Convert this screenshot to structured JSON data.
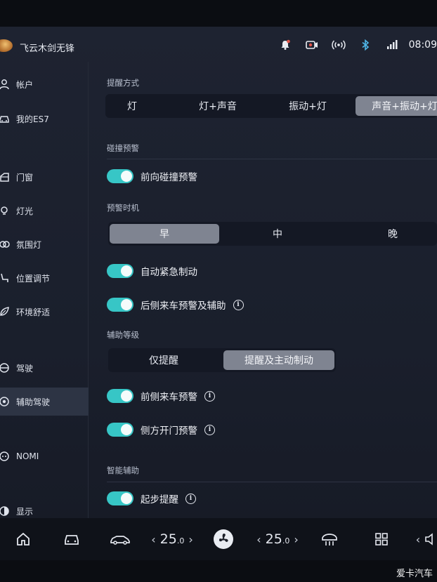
{
  "status_bar": {
    "username": "飞云木剑无锋",
    "time": "08:09",
    "icons": [
      "bell-icon",
      "camera-record-icon",
      "wireless-signal-icon",
      "bluetooth-icon",
      "cellular-signal-icon"
    ]
  },
  "sidebar": {
    "items": [
      {
        "label": "帐户",
        "icon": "user-icon"
      },
      {
        "label": "我的ES7",
        "icon": "car-icon"
      },
      {
        "label": "门窗",
        "icon": "door-icon"
      },
      {
        "label": "灯光",
        "icon": "light-icon"
      },
      {
        "label": "氛围灯",
        "icon": "ambient-light-icon"
      },
      {
        "label": "位置调节",
        "icon": "seat-icon"
      },
      {
        "label": "环境舒适",
        "icon": "leaf-icon"
      },
      {
        "label": "驾驶",
        "icon": "steering-wheel-icon"
      },
      {
        "label": "辅助驾驶",
        "icon": "assist-driving-icon",
        "active": true
      },
      {
        "label": "NOMI",
        "icon": "nomi-icon"
      },
      {
        "label": "显示",
        "icon": "display-icon"
      }
    ]
  },
  "main": {
    "alert_mode": {
      "title": "提醒方式",
      "options": [
        "灯",
        "灯+声音",
        "振动+灯",
        "声音+振动+灯"
      ],
      "selected": "声音+振动+灯"
    },
    "collision": {
      "title": "碰撞预警",
      "forward_collision": {
        "label": "前向碰撞预警",
        "on": true
      }
    },
    "timing": {
      "title": "预警时机",
      "options": [
        "早",
        "中",
        "晚"
      ],
      "selected": "早"
    },
    "aeb": {
      "label": "自动紧急制动",
      "on": true
    },
    "rear_cross": {
      "label": "后侧来车预警及辅助",
      "on": true,
      "info": "i"
    },
    "assist_level": {
      "title": "辅助等级",
      "options": [
        "仅提醒",
        "提醒及主动制动"
      ],
      "selected": "提醒及主动制动"
    },
    "front_cross": {
      "label": "前侧来车预警",
      "on": true,
      "info": "i"
    },
    "door_open": {
      "label": "侧方开门预警",
      "on": true,
      "info": "i"
    },
    "smart_assist": {
      "title": "智能辅助",
      "start_reminder": {
        "label": "起步提醒",
        "on": true,
        "info": "i"
      }
    }
  },
  "dock": {
    "left_temp": "25",
    "left_temp_decimal": ".0",
    "right_temp": "25",
    "right_temp_decimal": ".0",
    "icons": [
      "home-icon",
      "car-front-icon",
      "car-side-icon",
      "fan-icon",
      "defrost-icon",
      "apps-grid-icon",
      "volume-icon"
    ]
  },
  "watermark": "爱卡汽车",
  "colors": {
    "accent_toggle": "#37c6c6",
    "selected_segment": "#7f8491",
    "background": "#1e2331"
  }
}
